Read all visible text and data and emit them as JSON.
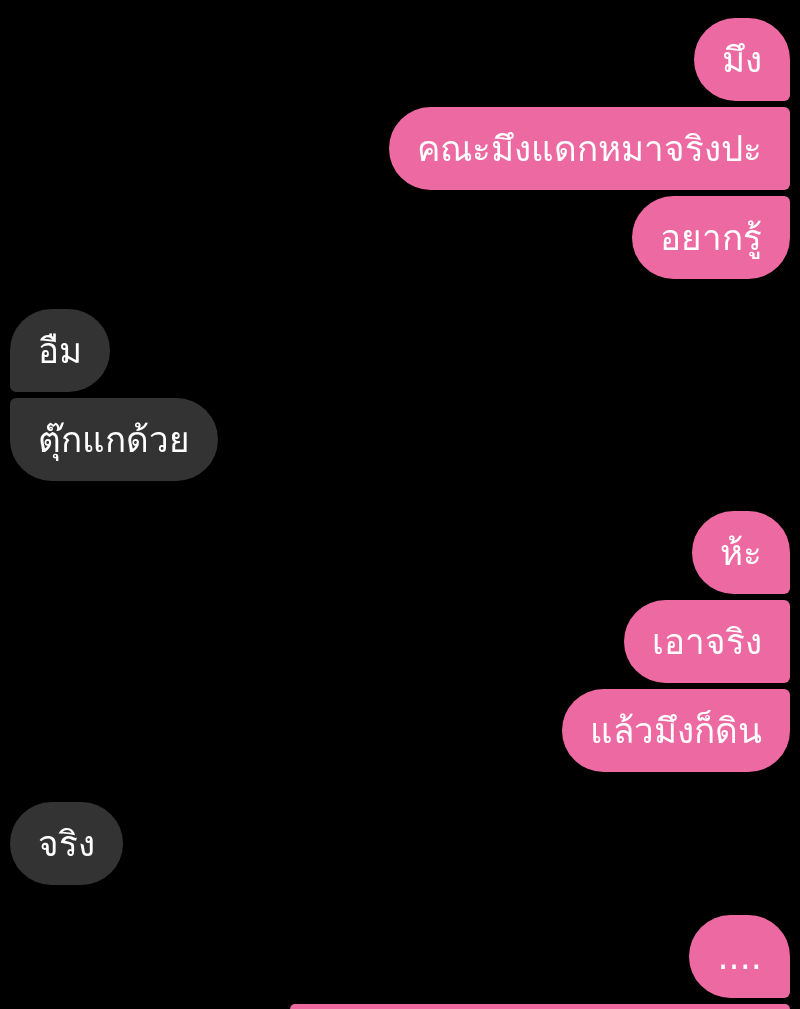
{
  "conversation": [
    {
      "outgoing": true,
      "messages": [
        {
          "kind": "text",
          "text": "มึง"
        },
        {
          "kind": "text",
          "text": "คณะมึงแดกหมาจริงปะ"
        },
        {
          "kind": "text",
          "text": "อยากรู้"
        }
      ]
    },
    {
      "outgoing": false,
      "messages": [
        {
          "kind": "text",
          "text": "อืม"
        },
        {
          "kind": "text",
          "text": "ตุ๊กแกด้วย"
        }
      ]
    },
    {
      "outgoing": true,
      "messages": [
        {
          "kind": "text",
          "text": "ห้ะ"
        },
        {
          "kind": "text",
          "text": "เอาจริง"
        },
        {
          "kind": "text",
          "text": "แล้วมึงก็ดิน"
        }
      ]
    },
    {
      "outgoing": false,
      "messages": [
        {
          "kind": "text",
          "text": "จริง"
        }
      ]
    },
    {
      "outgoing": true,
      "messages": [
        {
          "kind": "text",
          "text": "...."
        },
        {
          "kind": "cut"
        }
      ]
    }
  ]
}
